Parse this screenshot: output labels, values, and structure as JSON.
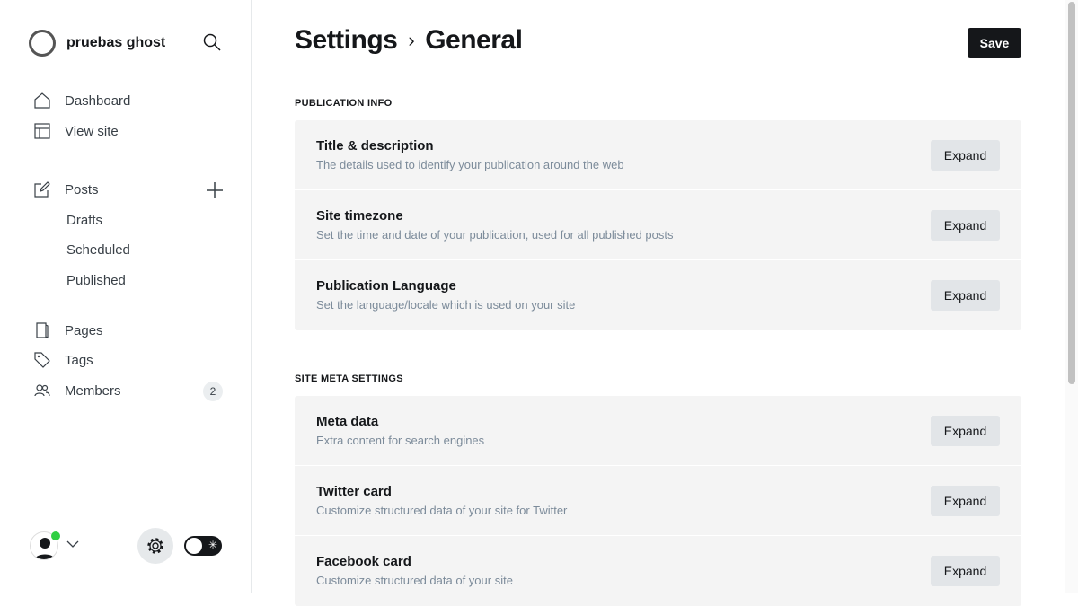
{
  "sidebar": {
    "site_name": "pruebas ghost",
    "nav": [
      {
        "label": "Dashboard"
      },
      {
        "label": "View site"
      },
      {
        "label": "Posts"
      },
      {
        "label": "Pages"
      },
      {
        "label": "Tags"
      },
      {
        "label": "Members",
        "badge": "2"
      }
    ],
    "posts_sub": [
      "Drafts",
      "Scheduled",
      "Published"
    ]
  },
  "header": {
    "crumb1": "Settings",
    "crumb2": "General",
    "save_label": "Save"
  },
  "sections": [
    {
      "title": "PUBLICATION INFO",
      "rows": [
        {
          "title": "Title & description",
          "desc": "The details used to identify your publication around the web",
          "button": "Expand"
        },
        {
          "title": "Site timezone",
          "desc": "Set the time and date of your publication, used for all published posts",
          "button": "Expand"
        },
        {
          "title": "Publication Language",
          "desc": "Set the language/locale which is used on your site",
          "button": "Expand"
        }
      ]
    },
    {
      "title": "SITE META SETTINGS",
      "rows": [
        {
          "title": "Meta data",
          "desc": "Extra content for search engines",
          "button": "Expand"
        },
        {
          "title": "Twitter card",
          "desc": "Customize structured data of your site for Twitter",
          "button": "Expand"
        },
        {
          "title": "Facebook card",
          "desc": "Customize structured data of your site",
          "button": "Expand"
        }
      ]
    }
  ],
  "colors": {
    "accent": "#15171a",
    "online": "#30cf43"
  }
}
